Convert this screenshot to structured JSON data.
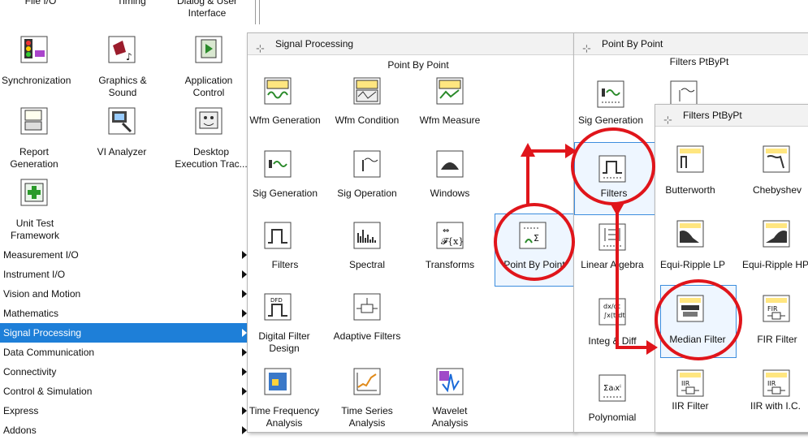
{
  "palette": {
    "top_labels": [
      "File I/O",
      "Timing",
      "Dialog & User Interface"
    ],
    "icons": [
      {
        "label": "Synchronization",
        "icon": "synchronization-icon"
      },
      {
        "label": "Graphics & Sound",
        "icon": "graphics-sound-icon"
      },
      {
        "label": "Application Control",
        "icon": "application-control-icon"
      },
      {
        "label": "Report Generation",
        "icon": "report-generation-icon"
      },
      {
        "label": "VI Analyzer",
        "icon": "vi-analyzer-icon"
      },
      {
        "label": "Desktop Execution Trac...",
        "icon": "desktop-execution-trace-icon"
      },
      {
        "label": "Unit Test Framework",
        "icon": "unit-test-framework-icon"
      }
    ],
    "categories": [
      "Measurement I/O",
      "Instrument I/O",
      "Vision and Motion",
      "Mathematics",
      "Signal Processing",
      "Data Communication",
      "Connectivity",
      "Control & Simulation",
      "Express",
      "Addons"
    ],
    "selected_category": "Signal Processing"
  },
  "signal_processing_panel": {
    "title": "Signal Processing",
    "subtitle": "Point By Point",
    "items": [
      "Wfm Generation",
      "Wfm Condition",
      "Wfm Measure",
      "Sig Generation",
      "Sig Operation",
      "Windows",
      "Filters",
      "Spectral",
      "Transforms",
      "Point By Point",
      "Digital Filter Design",
      "Adaptive Filters",
      "Time Frequency Analysis",
      "Time Series Analysis",
      "Wavelet Analysis"
    ]
  },
  "point_by_point_panel": {
    "title": "Point By Point",
    "subtitle": "Filters PtByPt",
    "items": [
      "Sig Generation",
      "Filters",
      "Linear Algebra",
      "Integ & Diff",
      "Polynomial"
    ]
  },
  "filters_ptbypt_panel": {
    "title": "Filters PtByPt",
    "items": [
      "Butterworth",
      "Chebyshev",
      "Equi-Ripple LP",
      "Equi-Ripple HP",
      "Median Filter",
      "FIR Filter",
      "IIR Filter",
      "IIR with I.C."
    ]
  },
  "annotation_color": "#e0151b"
}
